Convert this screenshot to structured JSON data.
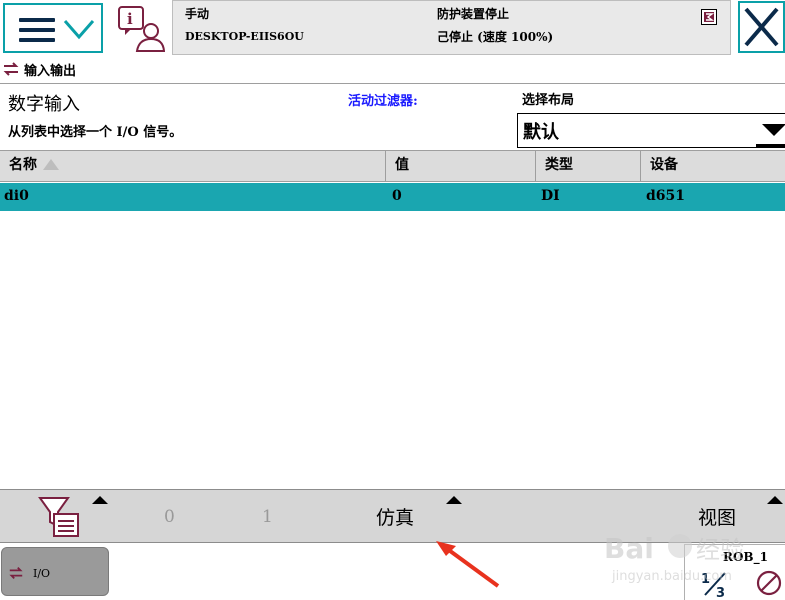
{
  "header": {
    "mode": "手动",
    "hostname": "DESKTOP-EIIS6OU",
    "guard_status": "防护装置停止",
    "run_status": "己停止 (速度 100%)"
  },
  "window": {
    "title": "输入输出"
  },
  "section": {
    "title": "数字输入",
    "subtitle": "从列表中选择一个 I/O 信号。",
    "active_filter_label": "活动过滤器:",
    "layout_label": "选择布局",
    "layout_value": "默认"
  },
  "table": {
    "columns": [
      "名称",
      "值",
      "类型",
      "设备"
    ],
    "rows": [
      {
        "name": "di0",
        "value": "0",
        "type": "DI",
        "device": "d651",
        "selected": true
      }
    ]
  },
  "toolbar": {
    "page_0": "0",
    "page_1": "1",
    "simulate_label": "仿真",
    "view_label": "视图"
  },
  "footer": {
    "task_label": "I/O",
    "robot_name": "ROB_1",
    "fraction": "1/3"
  },
  "colors": {
    "accent": "#0aa0a8",
    "selected_row": "#1aa6b0",
    "filter_text": "#1a1aff",
    "annotation_arrow": "#e8321e"
  },
  "icons": [
    "menu-icon",
    "chevron-down-icon",
    "info-user-icon",
    "hold-to-run-icon",
    "close-icon",
    "io-icon",
    "sort-ascending-icon",
    "dropdown-caret-icon",
    "filter-icon",
    "robot-fraction-icon",
    "no-sign-icon"
  ]
}
